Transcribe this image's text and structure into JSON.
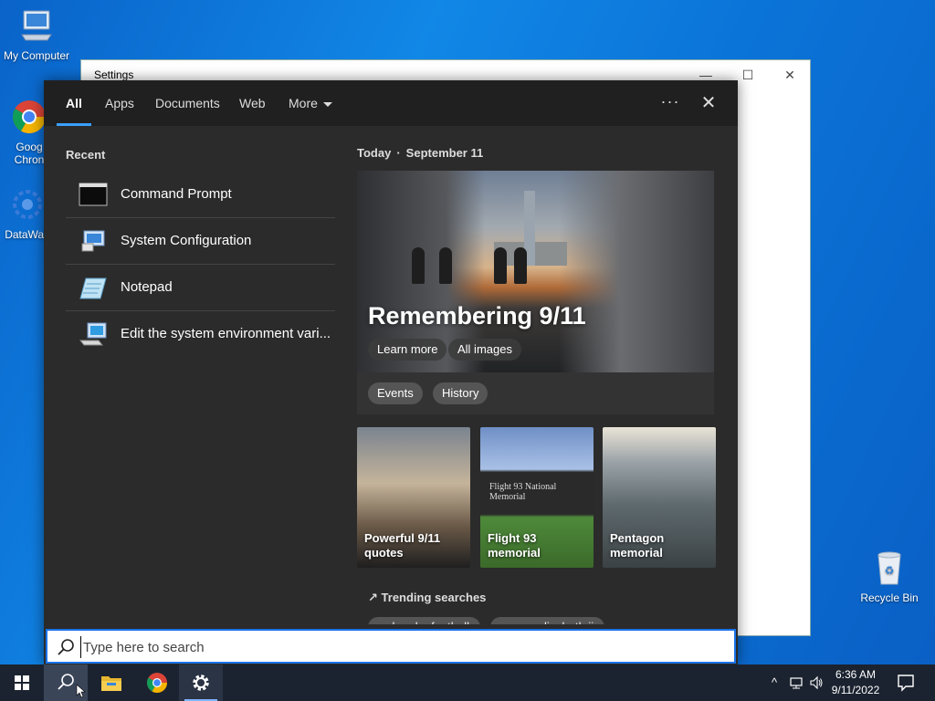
{
  "desktop": {
    "icons": [
      {
        "label": "My Computer"
      },
      {
        "label": "Goog\nChron"
      },
      {
        "label": "DataWag"
      },
      {
        "label": "Recycle Bin"
      }
    ]
  },
  "settings_window": {
    "title": "Settings",
    "min": "—",
    "max": "☐",
    "close": "✕"
  },
  "search_panel": {
    "tabs": [
      {
        "label": "All",
        "active": true
      },
      {
        "label": "Apps"
      },
      {
        "label": "Documents"
      },
      {
        "label": "Web"
      },
      {
        "label": "More"
      }
    ],
    "more_options": "···",
    "close": "✕",
    "recent_title": "Recent",
    "recent_items": [
      {
        "label": "Command Prompt",
        "icon": "command-prompt-icon"
      },
      {
        "label": "System Configuration",
        "icon": "system-configuration-icon"
      },
      {
        "label": "Notepad",
        "icon": "notepad-icon"
      },
      {
        "label": "Edit the system environment vari...",
        "icon": "system-properties-icon"
      }
    ],
    "today": {
      "label": "Today",
      "separator": "·",
      "date": "September 11"
    },
    "hero": {
      "title": "Remembering 9/11",
      "buttons": [
        "Learn more",
        "All images"
      ]
    },
    "chips": [
      "Events",
      "History"
    ],
    "cards": [
      {
        "label": "Powerful 9/11 quotes"
      },
      {
        "label": "Flight 93 memorial",
        "sign": "Flight 93 National Memorial"
      },
      {
        "label": "Pentagon memorial"
      }
    ],
    "trending": {
      "title": "Trending searches",
      "items": [
        "nebraska football",
        "queen elizabeth ii"
      ]
    }
  },
  "search_box": {
    "placeholder": "Type here to search",
    "value": ""
  },
  "taskbar": {
    "clock_time": "6:36 AM",
    "clock_date": "9/11/2022"
  },
  "colors": {
    "accent": "#3ba0ff",
    "panel_bg": "#2b2b2b",
    "tabbar_bg": "#202020",
    "taskbar_bg": "#1b2330",
    "desktop_bg": "#0b74d8"
  }
}
